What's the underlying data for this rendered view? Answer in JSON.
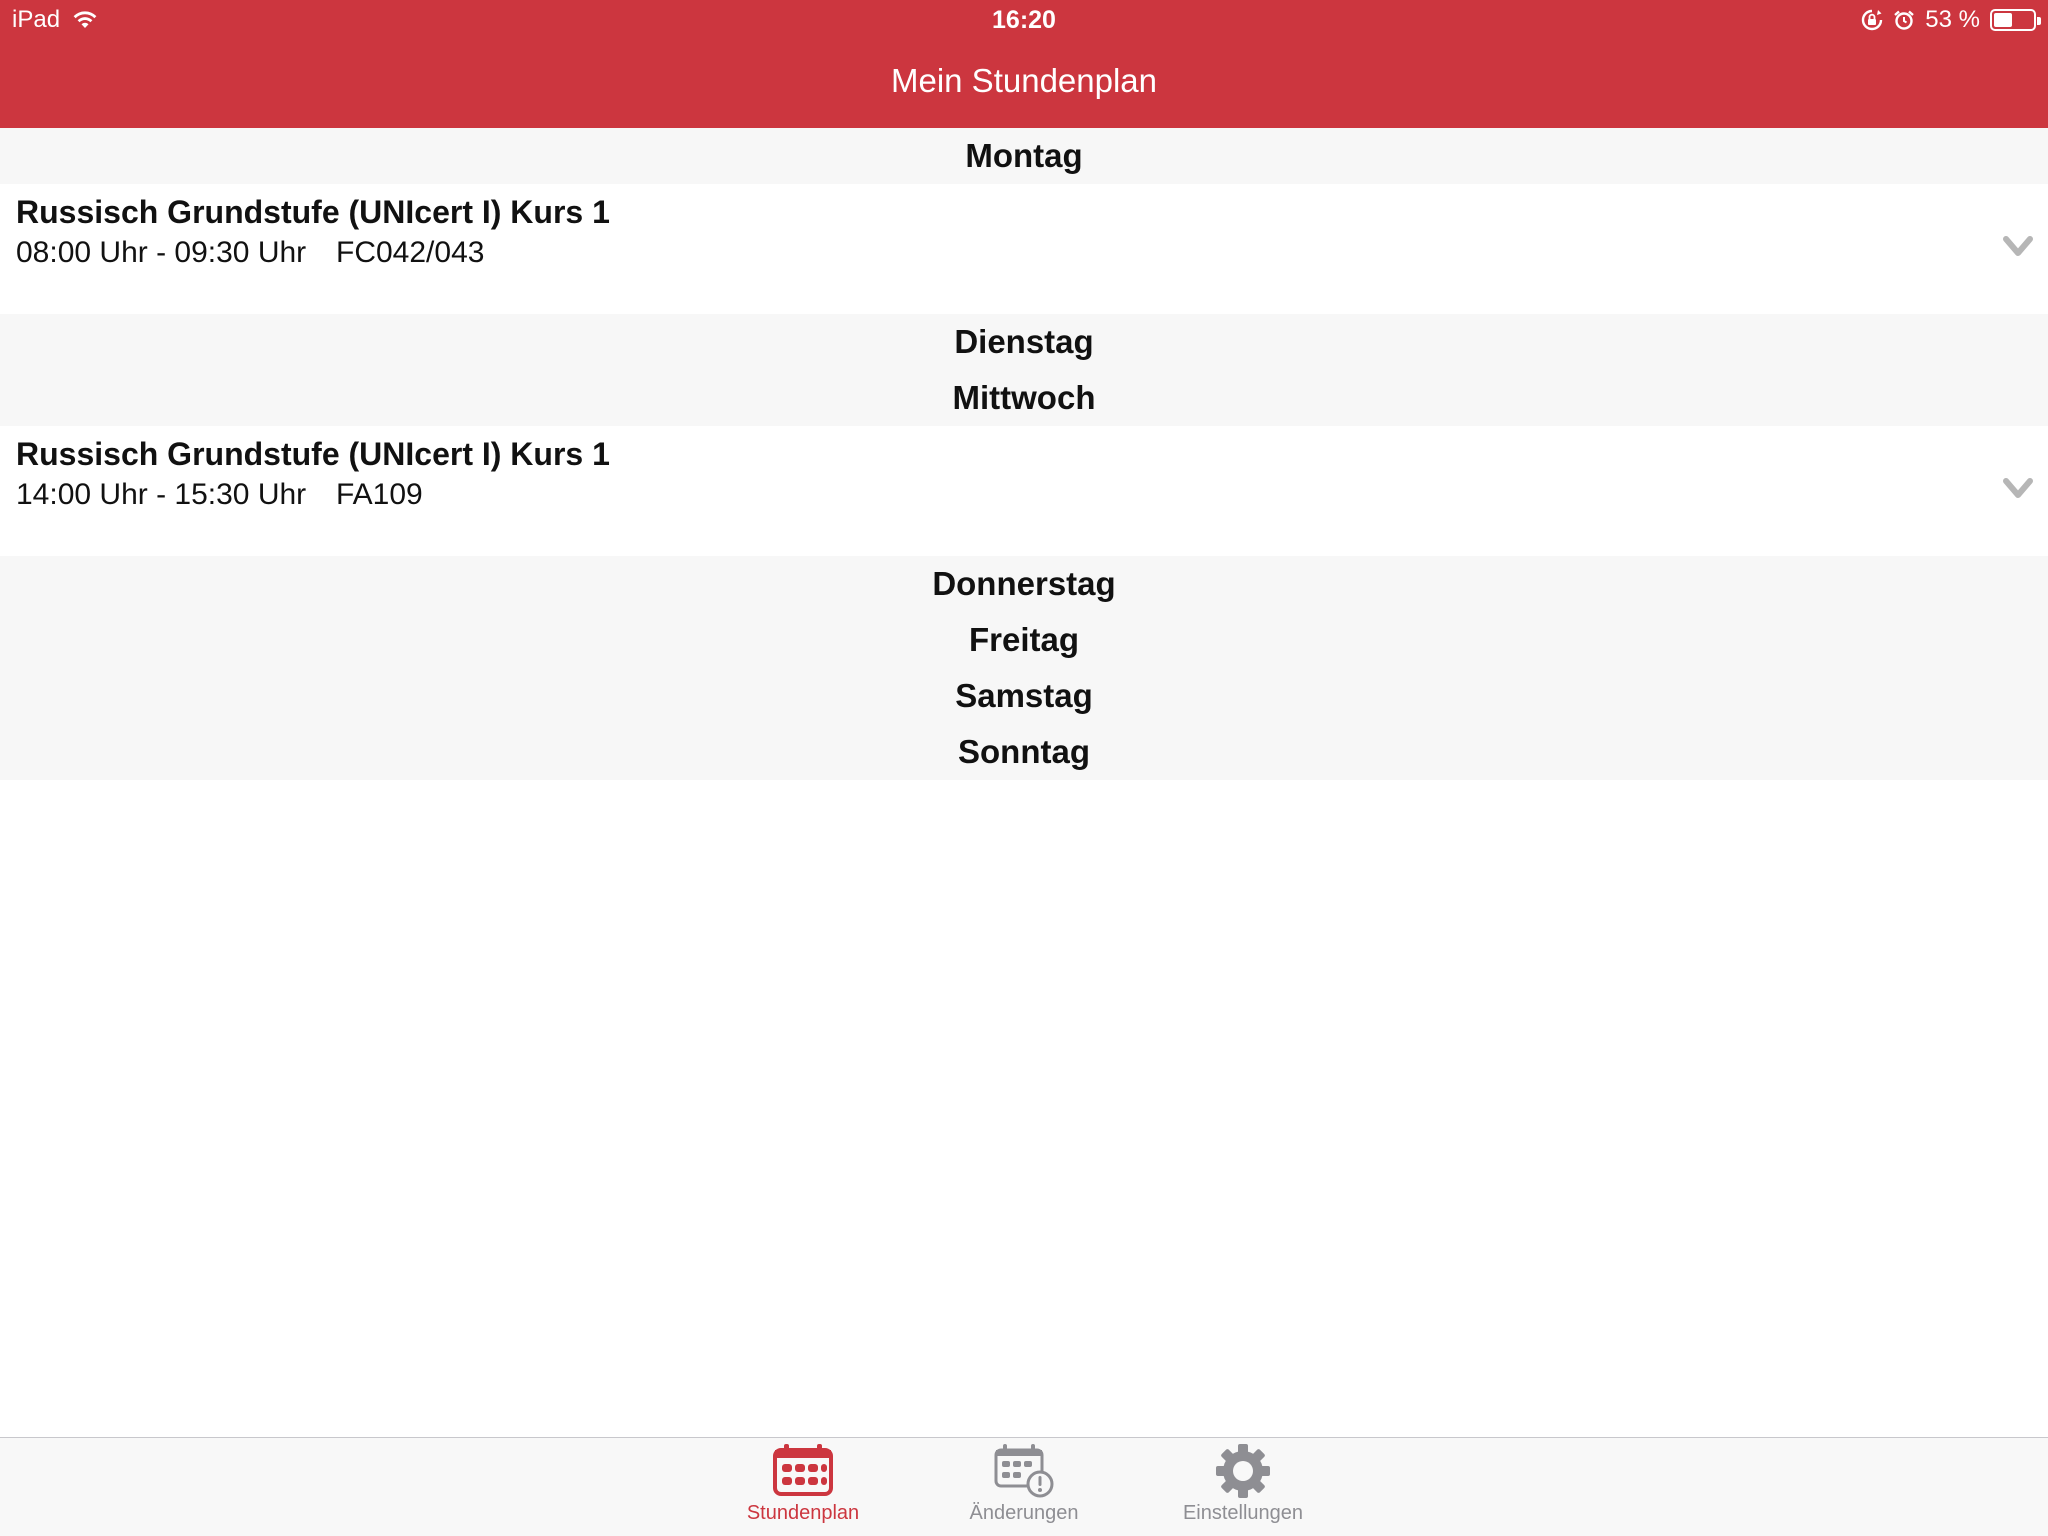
{
  "status_bar": {
    "device": "iPad",
    "time": "16:20",
    "battery": "53 %",
    "battery_level": 0.53
  },
  "nav": {
    "title": "Mein Stundenplan"
  },
  "colors": {
    "accent": "#cc363f",
    "section_bg": "#f7f7f7",
    "inactive": "#8e8e93"
  },
  "schedule": {
    "days": [
      {
        "name": "Montag",
        "lessons": [
          {
            "title": "Russisch Grundstufe (UNIcert I) Kurs 1",
            "time": "08:00 Uhr - 09:30 Uhr",
            "room": "FC042/043"
          }
        ]
      },
      {
        "name": "Dienstag",
        "lessons": []
      },
      {
        "name": "Mittwoch",
        "lessons": [
          {
            "title": "Russisch Grundstufe (UNIcert I) Kurs 1",
            "time": "14:00 Uhr - 15:30 Uhr",
            "room": "FA109"
          }
        ]
      },
      {
        "name": "Donnerstag",
        "lessons": []
      },
      {
        "name": "Freitag",
        "lessons": []
      },
      {
        "name": "Samstag",
        "lessons": []
      },
      {
        "name": "Sonntag",
        "lessons": []
      }
    ]
  },
  "tabs": [
    {
      "label": "Stundenplan",
      "icon": "calendar-icon",
      "active": true
    },
    {
      "label": "Änderungen",
      "icon": "calendar-alert-icon",
      "active": false
    },
    {
      "label": "Einstellungen",
      "icon": "gear-icon",
      "active": false
    }
  ]
}
